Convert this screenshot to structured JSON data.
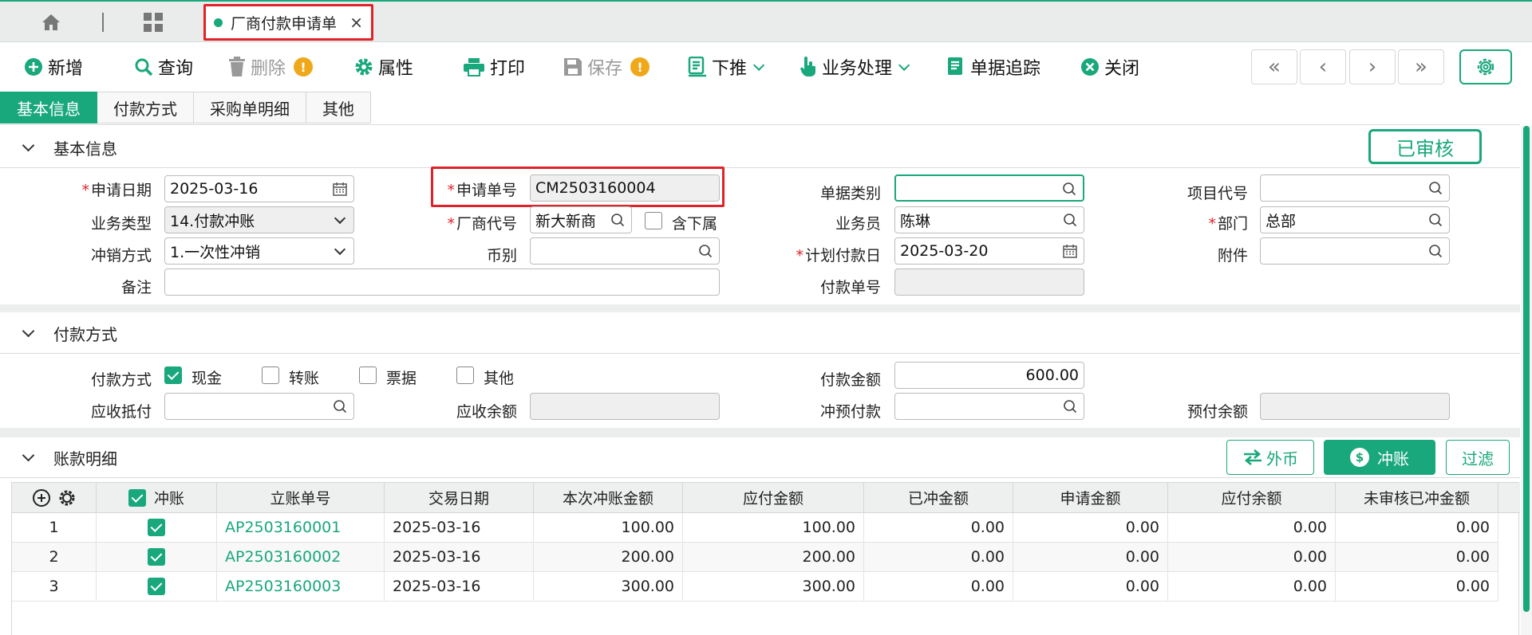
{
  "tabbar": {
    "doc_tab_title": "厂商付款申请单",
    "close_glyph": "×"
  },
  "toolbar": {
    "add": "新增",
    "query": "查询",
    "delete": "删除",
    "properties": "属性",
    "print": "打印",
    "save": "保存",
    "push_down": "下推",
    "business": "业务处理",
    "trace": "单据追踪",
    "close": "关闭",
    "warn_glyph": "!"
  },
  "nav": {
    "first": "«",
    "prev": "‹",
    "next": "›",
    "last": "»"
  },
  "section_tabs": [
    "基本信息",
    "付款方式",
    "采购单明细",
    "其他"
  ],
  "basic": {
    "title": "基本信息",
    "status": "已审核",
    "apply_date_label": "申请日期",
    "apply_date": "2025-03-16",
    "apply_no_label": "申请单号",
    "apply_no": "CM2503160004",
    "doc_type_label": "单据类别",
    "doc_type": "",
    "project_label": "项目代号",
    "project": "",
    "biz_type_label": "业务类型",
    "biz_type": "14.付款冲账",
    "vendor_label": "厂商代号",
    "vendor": "新大新商",
    "include_sub_label": "含下属",
    "salesman_label": "业务员",
    "salesman": "陈琳",
    "dept_label": "部门",
    "dept": "总部",
    "writeoff_label": "冲销方式",
    "writeoff": "1.一次性冲销",
    "currency_label": "币别",
    "currency": "",
    "plan_date_label": "计划付款日",
    "plan_date": "2025-03-20",
    "attach_label": "附件",
    "attach": "",
    "remark_label": "备注",
    "remark": "",
    "pay_no_label": "付款单号",
    "pay_no": ""
  },
  "payment": {
    "title": "付款方式",
    "method_label": "付款方式",
    "cash": "现金",
    "transfer": "转账",
    "bill": "票据",
    "other": "其他",
    "amount_label": "付款金额",
    "amount": "600.00",
    "ar_offset_label": "应收抵付",
    "ar_offset": "",
    "ar_balance_label": "应收余额",
    "ar_balance": "",
    "prepay_offset_label": "冲预付款",
    "prepay_offset": "",
    "prepay_balance_label": "预付余额",
    "prepay_balance": ""
  },
  "detail": {
    "title": "账款明细",
    "foreign_btn": "外币",
    "offset_btn": "冲账",
    "filter_btn": "过滤",
    "dollar_glyph": "$",
    "columns": [
      "冲账",
      "立账单号",
      "交易日期",
      "本次冲账金额",
      "应付金额",
      "已冲金额",
      "申请金额",
      "应付余额",
      "未审核已冲金额"
    ],
    "rows": [
      {
        "no": "1",
        "doc": "AP2503160001",
        "date": "2025-03-16",
        "this_amt": "100.00",
        "payable": "100.00",
        "offset": "0.00",
        "apply": "0.00",
        "balance": "0.00",
        "unaudited": "0.00"
      },
      {
        "no": "2",
        "doc": "AP2503160002",
        "date": "2025-03-16",
        "this_amt": "200.00",
        "payable": "200.00",
        "offset": "0.00",
        "apply": "0.00",
        "balance": "0.00",
        "unaudited": "0.00"
      },
      {
        "no": "3",
        "doc": "AP2503160003",
        "date": "2025-03-16",
        "this_amt": "300.00",
        "payable": "300.00",
        "offset": "0.00",
        "apply": "0.00",
        "balance": "0.00",
        "unaudited": "0.00"
      }
    ]
  },
  "colors": {
    "accent": "#19a77c",
    "highlight": "#e0232a",
    "warning": "#f0a81b"
  }
}
